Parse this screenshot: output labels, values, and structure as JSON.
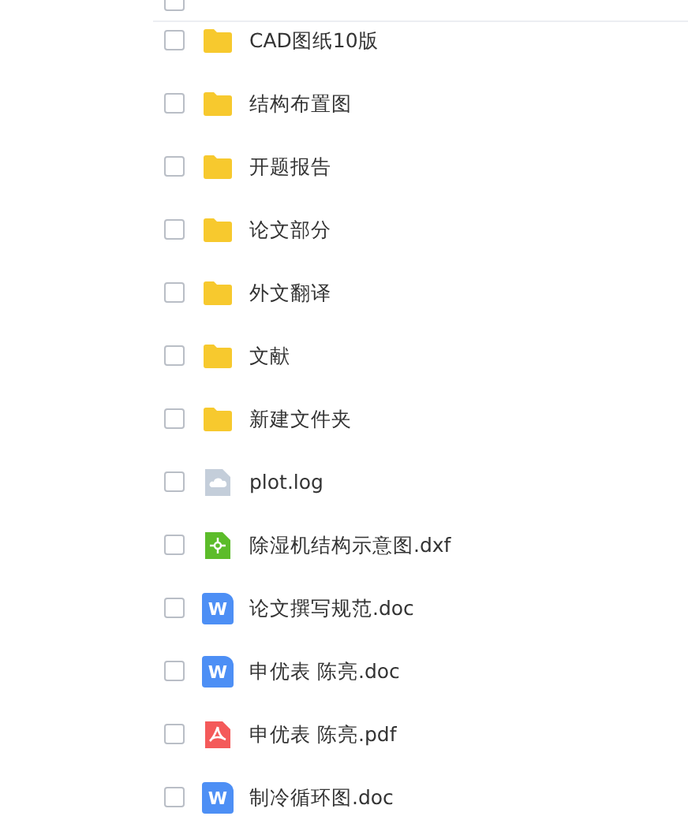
{
  "header": {
    "select_all_checked": false
  },
  "files": [
    {
      "name": "CAD图纸10版",
      "kind": "folder",
      "checked": false
    },
    {
      "name": "结构布置图",
      "kind": "folder",
      "checked": false
    },
    {
      "name": "开题报告",
      "kind": "folder",
      "checked": false
    },
    {
      "name": "论文部分",
      "kind": "folder",
      "checked": false
    },
    {
      "name": "外文翻译",
      "kind": "folder",
      "checked": false
    },
    {
      "name": "文献",
      "kind": "folder",
      "checked": false
    },
    {
      "name": "新建文件夹",
      "kind": "folder",
      "checked": false
    },
    {
      "name": "plot.log",
      "kind": "log",
      "checked": false
    },
    {
      "name": "除湿机结构示意图.dxf",
      "kind": "dxf",
      "checked": false
    },
    {
      "name": "论文撰写规范.doc",
      "kind": "doc",
      "badge": "W",
      "checked": false
    },
    {
      "name": "申优表 陈亮.doc",
      "kind": "doc",
      "badge": "W",
      "checked": false
    },
    {
      "name": "申优表 陈亮.pdf",
      "kind": "pdf",
      "checked": false
    },
    {
      "name": "制冷循环图.doc",
      "kind": "doc",
      "badge": "W",
      "checked": false
    }
  ]
}
